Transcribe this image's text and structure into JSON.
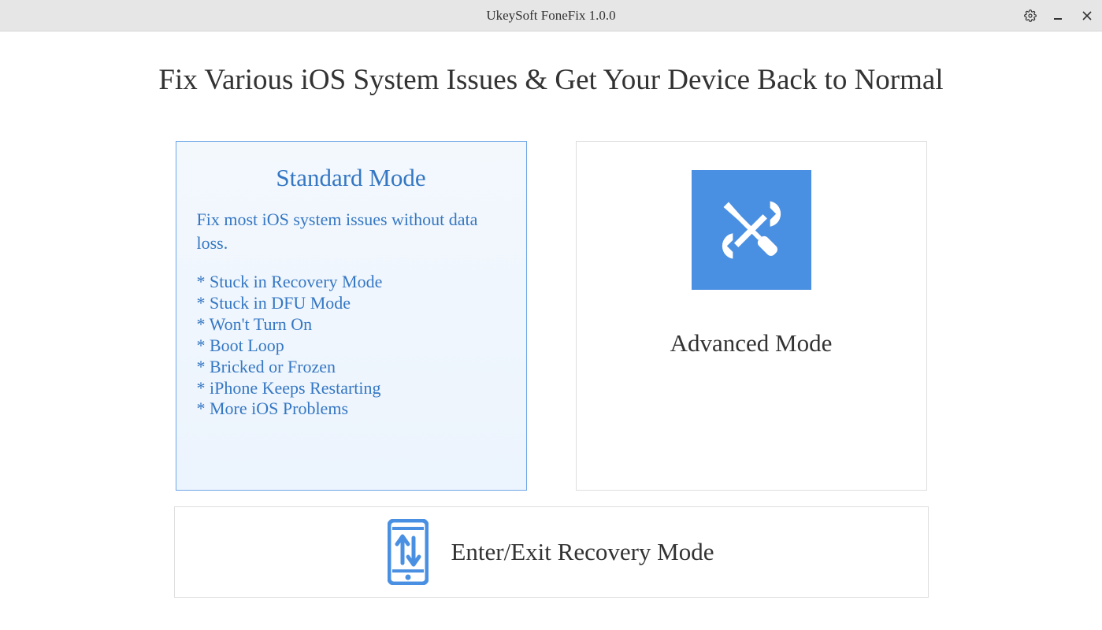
{
  "window": {
    "title": "UkeySoft FoneFix 1.0.0"
  },
  "heading": "Fix Various iOS System Issues & Get Your Device Back to Normal",
  "standard": {
    "title": "Standard Mode",
    "description": "Fix most iOS system issues without data loss.",
    "items": [
      "* Stuck in Recovery Mode",
      "* Stuck in DFU Mode",
      "* Won't Turn On",
      "* Boot Loop",
      "* Bricked or Frozen",
      "* iPhone Keeps Restarting",
      "* More iOS Problems"
    ]
  },
  "advanced": {
    "title": "Advanced Mode"
  },
  "recovery": {
    "title": "Enter/Exit Recovery Mode"
  },
  "colors": {
    "accent_blue": "#4a90e2",
    "link_blue": "#3577c3"
  }
}
